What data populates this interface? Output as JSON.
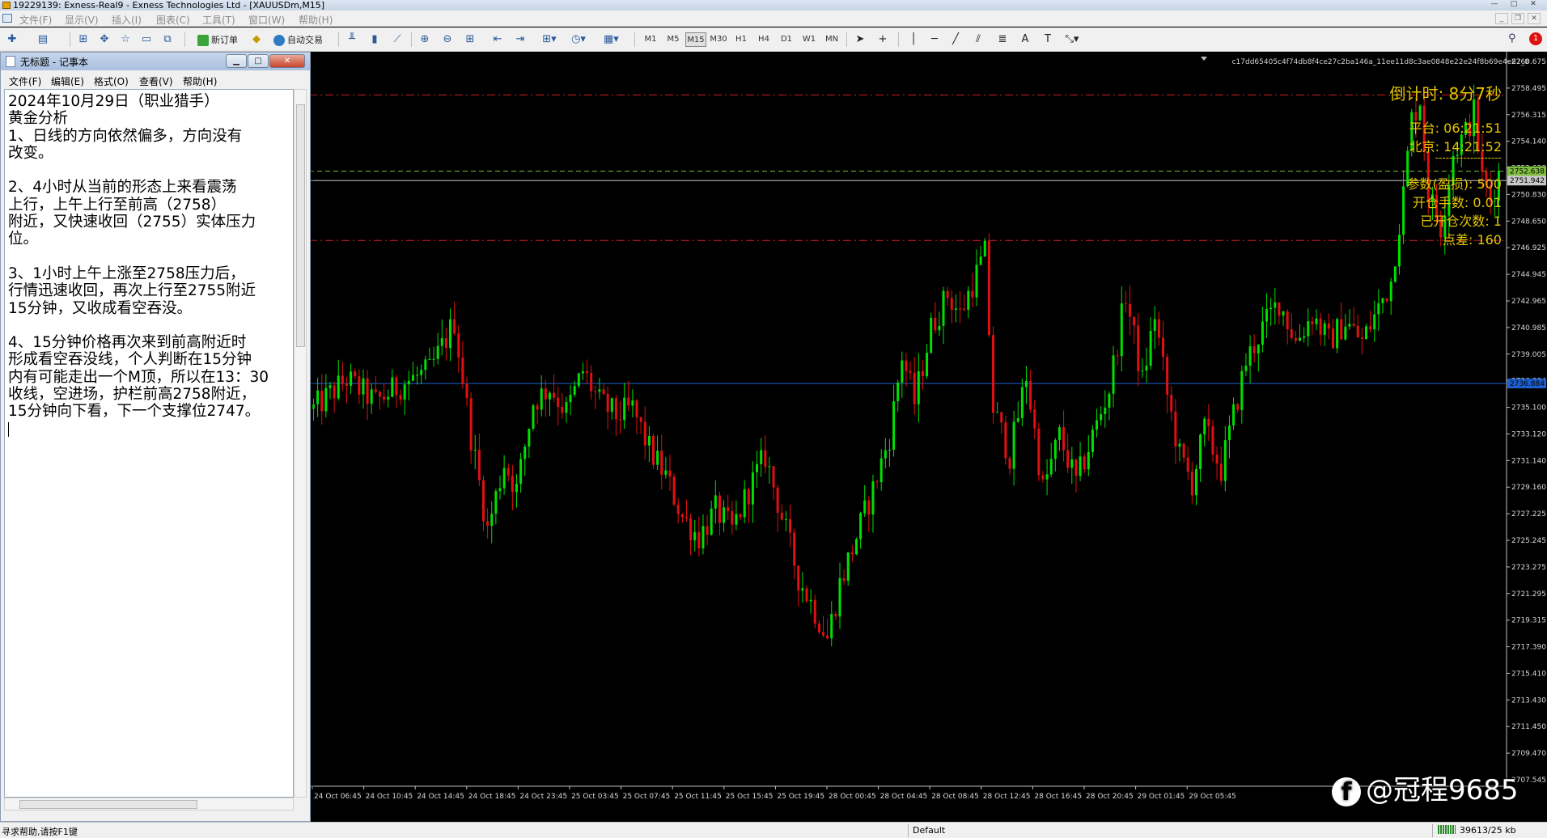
{
  "window": {
    "title": "19229139: Exness-Real9 - Exness Technologies Ltd - [XAUUSDm,M15]",
    "controls": [
      "—",
      "□",
      "✕"
    ]
  },
  "menubar": {
    "items": [
      "文件(F)",
      "显示(V)",
      "插入(I)",
      "图表(C)",
      "工具(T)",
      "窗口(W)",
      "帮助(H)"
    ]
  },
  "toolbar": {
    "new_order_label": "新订单",
    "auto_trade_label": "自动交易",
    "timeframes": [
      "M1",
      "M5",
      "M15",
      "M30",
      "H1",
      "H4",
      "D1",
      "W1",
      "MN"
    ],
    "text_tool": "A",
    "label_tool": "T",
    "alert_count": "1"
  },
  "chart": {
    "id_string": "c17dd65405c4f74db8f4ce27c2ba146a_11ee11d8c3ae0848e22e24f8b69e4e82_8",
    "countdown": "倒计时: 8分7秒",
    "platform_time": "平台: 06:21:51",
    "beijing_time": "北京: 14:21:52",
    "separator": "-------------------",
    "param_stoploss": "参数(盈损): 500",
    "open_lots": "开仓手数: 0.01",
    "opened_count": "已开仓次数: 1",
    "spread": "点差: 160",
    "colors": {
      "bull": "#00e000",
      "bear": "#e01010",
      "red_line": "#d02020",
      "green_line": "#7fbf3f",
      "bid_line": "#c8c8c8",
      "blue_line": "#1e5fd0",
      "overlay_text": "#e6c700"
    }
  },
  "chart_data": {
    "type": "candlestick",
    "symbol": "XAUUSDm",
    "timeframe": "M15",
    "ylim": [
      2707.0,
      2761.5
    ],
    "yticks": [
      "2760.675",
      "2758.490",
      "2756.305",
      "2754.120",
      "2751.942",
      "2749.750",
      "2747.565",
      "2745.380",
      "2743.195",
      "2741.010",
      "2738.825",
      "2736.640",
      "2734.455",
      "2732.270",
      "2730.085",
      "2727.900",
      "2725.715",
      "2723.530",
      "2721.345",
      "2719.160",
      "2716.975",
      "2714.790",
      "2712.605",
      "2710.420",
      "2708.235"
    ],
    "ytick_labels": [
      "2760.675",
      "2758.495",
      "2756.315",
      "2754.140",
      "2752.638",
      "2750.830",
      "2748.650",
      "2746.925",
      "2744.945",
      "2742.965",
      "2740.985",
      "2739.005",
      "2736.884",
      "2735.100",
      "2733.120",
      "2731.140",
      "2729.160",
      "2727.225",
      "2725.245",
      "2723.275",
      "2721.295",
      "2719.315",
      "2717.390",
      "2715.410",
      "2713.430",
      "2711.450",
      "2709.470",
      "2707.545"
    ],
    "xtick_labels": [
      "24 Oct 06:45",
      "24 Oct 10:45",
      "24 Oct 14:45",
      "24 Oct 18:45",
      "24 Oct 23:45",
      "25 Oct 03:45",
      "25 Oct 07:45",
      "25 Oct 11:45",
      "25 Oct 15:45",
      "25 Oct 19:45",
      "28 Oct 00:45",
      "28 Oct 04:45",
      "28 Oct 08:45",
      "28 Oct 12:45",
      "28 Oct 16:45",
      "28 Oct 20:45",
      "29 Oct 01:45",
      "29 Oct 05:45"
    ],
    "horizontal_lines": [
      {
        "name": "resistance",
        "price": 2758.3,
        "style": "dash-dot",
        "color": "#d02020"
      },
      {
        "name": "ask",
        "price": 2752.638,
        "label": "2752.638",
        "style": "dashed",
        "color": "#7fbf3f"
      },
      {
        "name": "bid",
        "price": 2751.942,
        "label": "2751.942",
        "style": "solid",
        "color": "#c8c8c8"
      },
      {
        "name": "support",
        "price": 2747.5,
        "style": "dash-dot",
        "color": "#d02020"
      },
      {
        "name": "level",
        "price": 2736.884,
        "label": "2736.884",
        "style": "solid",
        "color": "#1e5fd0"
      }
    ],
    "path": [
      [
        0,
        2735.0
      ],
      [
        8,
        2737.2
      ],
      [
        15,
        2735.5
      ],
      [
        22,
        2737.0
      ],
      [
        28,
        2737.8
      ],
      [
        32,
        2740.2
      ],
      [
        34,
        2741.5
      ],
      [
        38,
        2733.0
      ],
      [
        42,
        2726.0
      ],
      [
        46,
        2731.0
      ],
      [
        49,
        2729.0
      ],
      [
        53,
        2735.5
      ],
      [
        57,
        2736.6
      ],
      [
        61,
        2734.8
      ],
      [
        65,
        2737.8
      ],
      [
        69,
        2735.5
      ],
      [
        73,
        2734.5
      ],
      [
        77,
        2735.0
      ],
      [
        81,
        2732.0
      ],
      [
        85,
        2730.0
      ],
      [
        89,
        2727.0
      ],
      [
        93,
        2725.5
      ],
      [
        97,
        2727.5
      ],
      [
        101,
        2726.0
      ],
      [
        105,
        2729.0
      ],
      [
        109,
        2731.5
      ],
      [
        113,
        2727.0
      ],
      [
        117,
        2722.5
      ],
      [
        121,
        2720.0
      ],
      [
        124,
        2718.0
      ],
      [
        127,
        2722.0
      ],
      [
        131,
        2725.5
      ],
      [
        135,
        2729.0
      ],
      [
        139,
        2733.0
      ],
      [
        142,
        2739.0
      ],
      [
        145,
        2735.5
      ],
      [
        149,
        2741.0
      ],
      [
        153,
        2743.5
      ],
      [
        156,
        2742.0
      ],
      [
        159,
        2744.3
      ],
      [
        162,
        2746.5
      ],
      [
        164,
        2735.0
      ],
      [
        168,
        2731.5
      ],
      [
        172,
        2737.5
      ],
      [
        176,
        2729.0
      ],
      [
        180,
        2733.0
      ],
      [
        184,
        2729.5
      ],
      [
        188,
        2733.0
      ],
      [
        192,
        2736.5
      ],
      [
        196,
        2743.5
      ],
      [
        200,
        2737.0
      ],
      [
        203,
        2742.0
      ],
      [
        206,
        2736.0
      ],
      [
        209,
        2731.5
      ],
      [
        212,
        2729.5
      ],
      [
        215,
        2733.5
      ],
      [
        219,
        2730.5
      ],
      [
        222,
        2734.5
      ],
      [
        225,
        2738.5
      ],
      [
        229,
        2741.0
      ],
      [
        233,
        2743.0
      ],
      [
        237,
        2740.0
      ],
      [
        241,
        2742.0
      ],
      [
        245,
        2740.0
      ],
      [
        249,
        2741.5
      ],
      [
        253,
        2740.0
      ],
      [
        257,
        2742.5
      ],
      [
        260,
        2744.5
      ],
      [
        263,
        2751.0
      ],
      [
        265,
        2756.5
      ],
      [
        267,
        2758.0
      ],
      [
        269,
        2751.0
      ],
      [
        272,
        2748.5
      ],
      [
        275,
        2754.0
      ],
      [
        278,
        2755.5
      ],
      [
        280,
        2757.0
      ],
      [
        282,
        2752.0
      ],
      [
        284,
        2750.5
      ],
      [
        286,
        2752.5
      ]
    ],
    "candle_count": 287
  },
  "notepad": {
    "title": "无标题 - 记事本",
    "menu": [
      "文件(F)",
      "编辑(E)",
      "格式(O)",
      "查看(V)",
      "帮助(H)"
    ],
    "lines": [
      "2024年10月29日（职业猎手）",
      "黄金分析",
      "1、日线的方向依然偏多，方向没有",
      "改变。",
      "",
      "2、4小时从当前的形态上来看震荡",
      "上行，上午上行至前高（2758）",
      "附近，又快速收回（2755）实体压力",
      "位。",
      "",
      "3、1小时上午上涨至2758压力后，",
      "行情迅速收回，再次上行至2755附近",
      "15分钟，又收成看空吞没。",
      "",
      "4、15分钟价格再次来到前高附近时",
      "形成看空吞没线，个人判断在15分钟",
      "内有可能走出一个M顶，所以在13：30",
      "收线，空进场，护栏前高2758附近，",
      "15分钟向下看，下一个支撑位2747。",
      ""
    ]
  },
  "statusbar": {
    "help_text": "寻求帮助,请按F1键",
    "profile": "Default",
    "traffic": "39613/25 kb"
  },
  "watermark": {
    "text": "@冠程9685"
  }
}
